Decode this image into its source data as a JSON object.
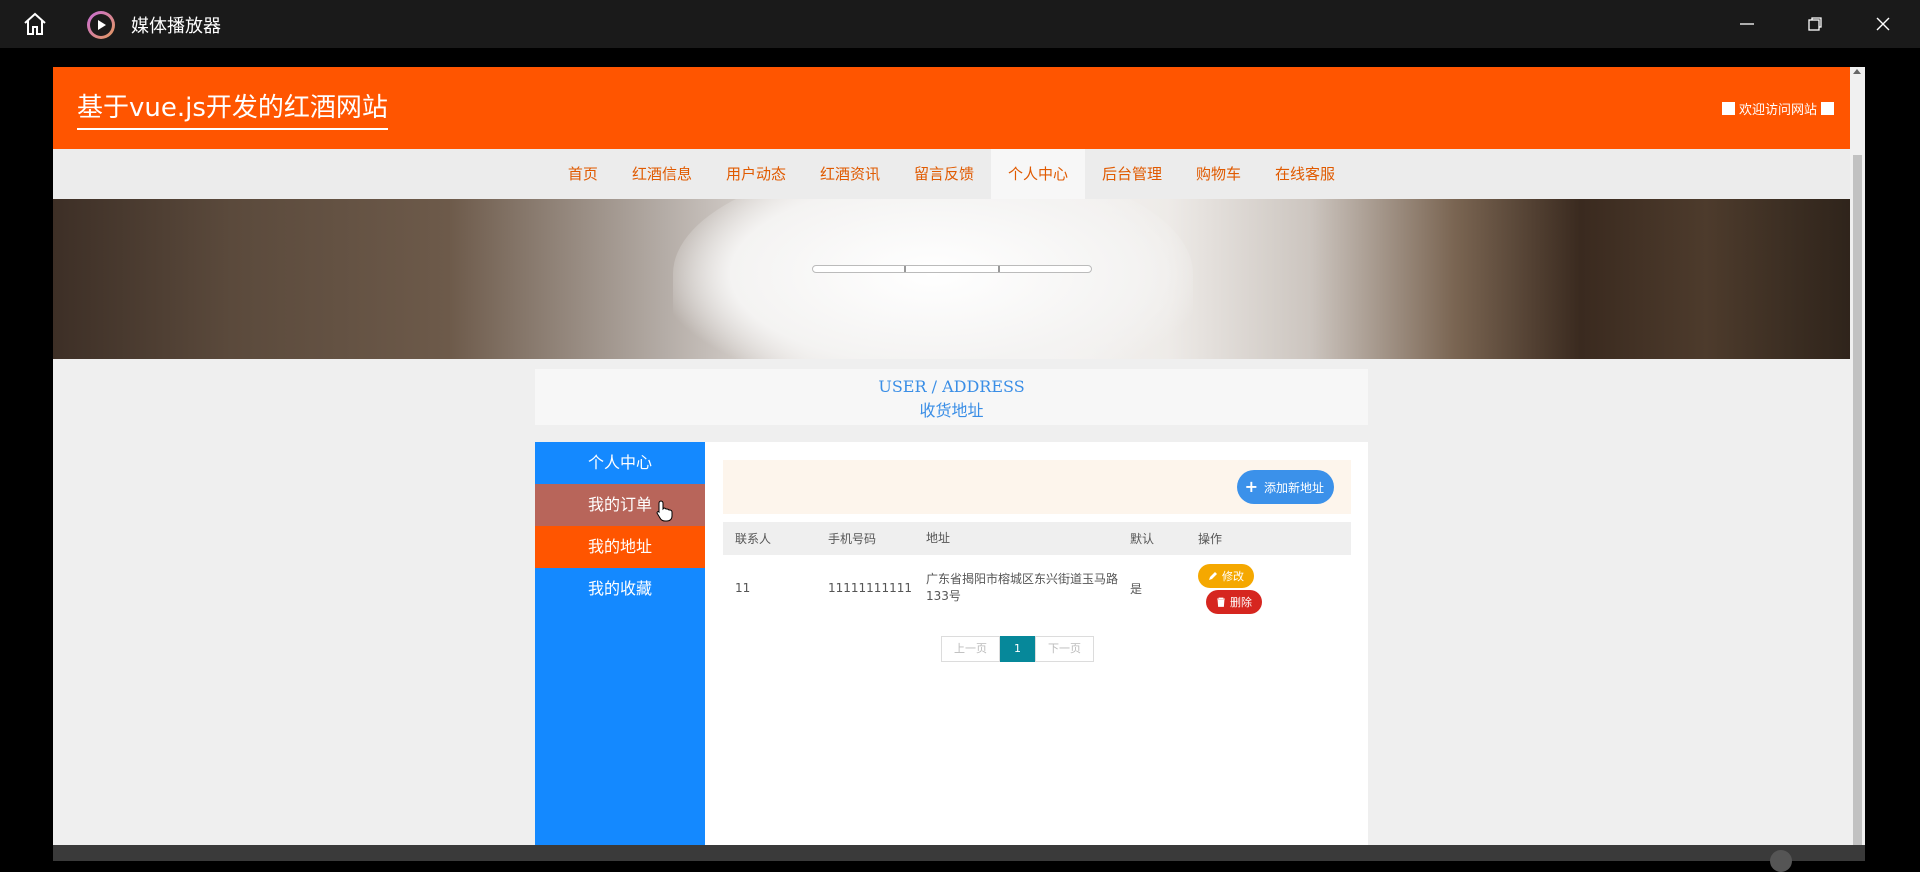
{
  "window": {
    "title": "媒体播放器",
    "icons": {
      "home": "home-icon",
      "app": "media-player-icon",
      "minimize": "minimize-icon",
      "maximize": "restore-icon",
      "close": "close-icon"
    }
  },
  "site": {
    "title": "基于vue.js开发的红酒网站",
    "welcome": "欢迎访问网站",
    "colors": {
      "header": "#ff5500",
      "sidebar": "#1489ff",
      "accent_blue": "#3a8ee6",
      "page_current": "#06889a"
    }
  },
  "nav": {
    "items": [
      {
        "label": "首页"
      },
      {
        "label": "红酒信息"
      },
      {
        "label": "用户动态"
      },
      {
        "label": "红酒资讯"
      },
      {
        "label": "留言反馈"
      },
      {
        "label": "个人中心"
      },
      {
        "label": "后台管理"
      },
      {
        "label": "购物车"
      },
      {
        "label": "在线客服"
      }
    ],
    "active": "个人中心"
  },
  "section": {
    "title_en": "USER / ADDRESS",
    "title_cn": "收货地址"
  },
  "sidebar": {
    "items": [
      {
        "label": "个人中心"
      },
      {
        "label": "我的订单"
      },
      {
        "label": "我的地址"
      },
      {
        "label": "我的收藏"
      }
    ],
    "active": "我的地址",
    "hovered": "我的订单"
  },
  "toolbar": {
    "add_label": "添加新地址"
  },
  "table": {
    "headers": [
      "联系人",
      "手机号码",
      "地址",
      "默认",
      "操作"
    ],
    "rows": [
      {
        "contact": "11",
        "phone": "11111111111",
        "address": "广东省揭阳市榕城区东兴街道玉马路133号",
        "default": "是",
        "edit": "修改",
        "delete": "删除"
      }
    ]
  },
  "pagination": {
    "prev": "上一页",
    "current": "1",
    "next": "下一页"
  }
}
